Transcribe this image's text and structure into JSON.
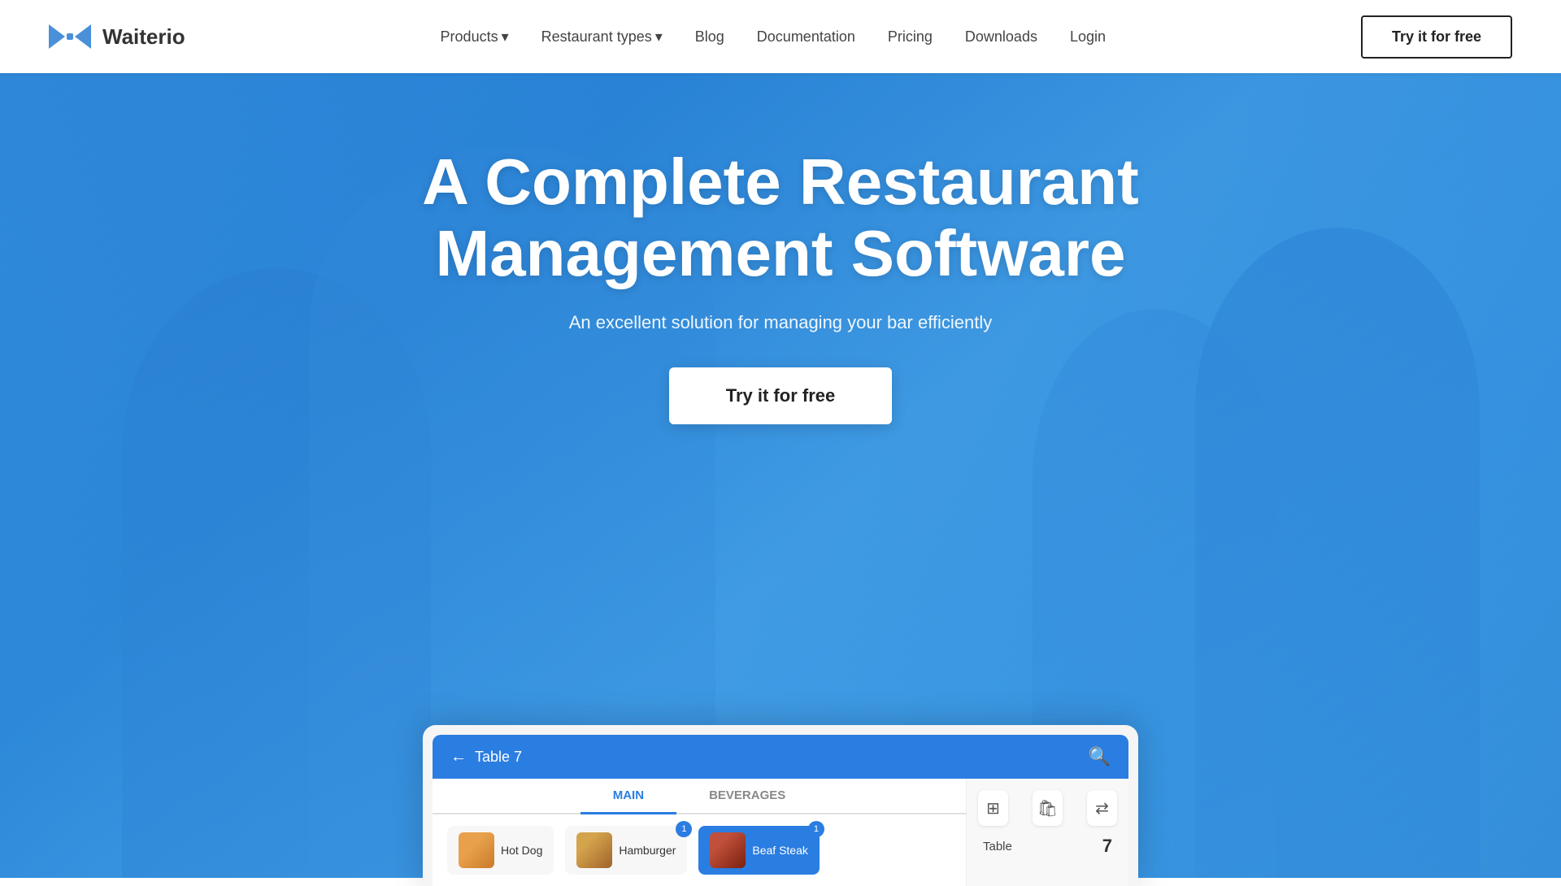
{
  "brand": {
    "name": "Waiterio",
    "logo_alt": "bowtie-logo"
  },
  "nav": {
    "links": [
      {
        "id": "products",
        "label": "Products",
        "has_dropdown": true
      },
      {
        "id": "restaurant-types",
        "label": "Restaurant types",
        "has_dropdown": true
      },
      {
        "id": "blog",
        "label": "Blog",
        "has_dropdown": false
      },
      {
        "id": "documentation",
        "label": "Documentation",
        "has_dropdown": false
      },
      {
        "id": "pricing",
        "label": "Pricing",
        "has_dropdown": false
      },
      {
        "id": "downloads",
        "label": "Downloads",
        "has_dropdown": false
      },
      {
        "id": "login",
        "label": "Login",
        "has_dropdown": false
      }
    ],
    "cta_label": "Try it for free"
  },
  "hero": {
    "title": "A Complete Restaurant Management Software",
    "subtitle": "An excellent solution for managing your bar efficiently",
    "cta_label": "Try it for free"
  },
  "app_preview": {
    "header": {
      "table_label": "Table 7",
      "back_arrow": "←"
    },
    "tabs": [
      {
        "id": "main",
        "label": "MAIN",
        "active": true
      },
      {
        "id": "beverages",
        "label": "BEVERAGES",
        "active": false
      }
    ],
    "menu_items": [
      {
        "id": "hotdog",
        "label": "Hot Dog",
        "badge": null
      },
      {
        "id": "hamburger",
        "label": "Hamburger",
        "badge": "1"
      },
      {
        "id": "beafsteak",
        "label": "Beaf Steak",
        "badge": "1",
        "selected": true
      }
    ],
    "right_panel": {
      "icons": [
        "⊞",
        "🛍",
        "⇄"
      ],
      "table_label": "Table",
      "table_number": "7"
    }
  }
}
